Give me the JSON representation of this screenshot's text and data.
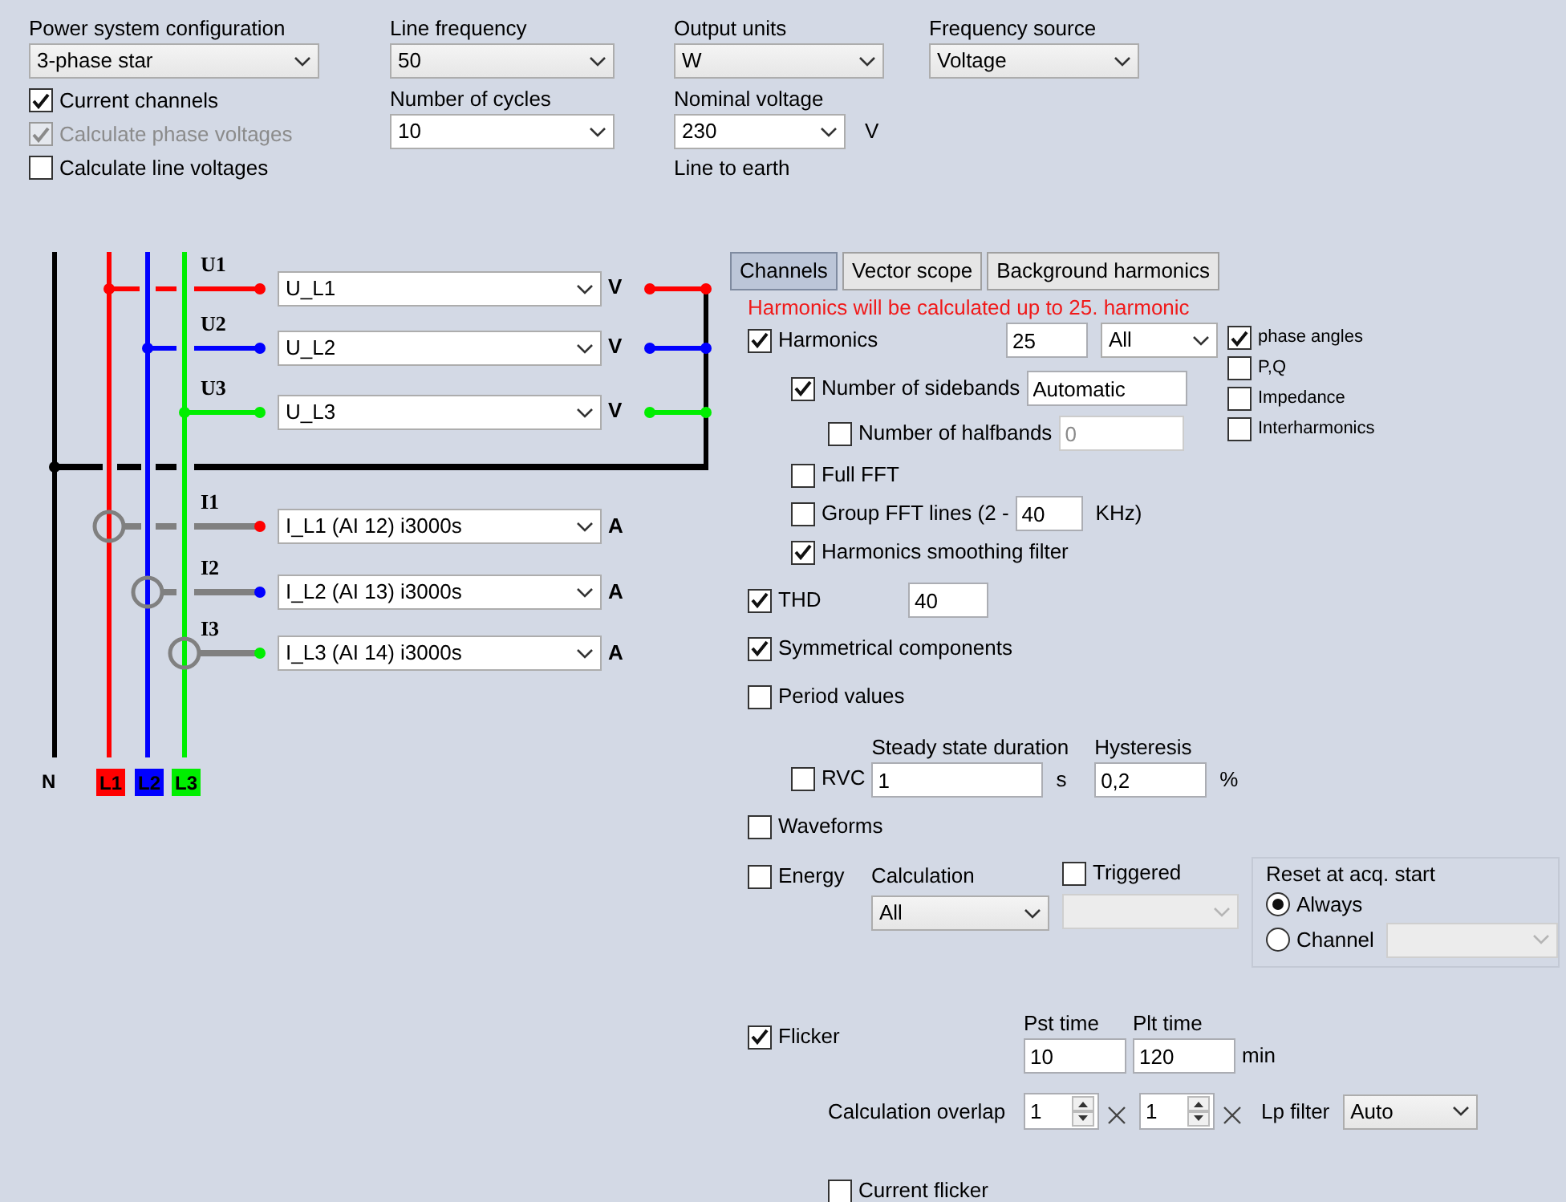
{
  "top": {
    "power_system_configuration": {
      "label": "Power system configuration",
      "value": "3-phase star"
    },
    "line_frequency": {
      "label": "Line frequency",
      "value": "50"
    },
    "output_units": {
      "label": "Output units",
      "value": "W"
    },
    "frequency_source": {
      "label": "Frequency source",
      "value": "Voltage"
    },
    "number_of_cycles": {
      "label": "Number of cycles",
      "value": "10"
    },
    "nominal_voltage": {
      "label": "Nominal voltage",
      "value": "230",
      "unit": "V",
      "note": "Line to earth"
    },
    "checkboxes": [
      {
        "label": "Current channels",
        "checked": true,
        "disabled": false
      },
      {
        "label": "Calculate phase voltages",
        "checked": true,
        "disabled": true
      },
      {
        "label": "Calculate line voltages",
        "checked": false,
        "disabled": false
      }
    ]
  },
  "diagram": {
    "neutral_label": "N",
    "phases": [
      {
        "label": "L1",
        "color": "#ff0000"
      },
      {
        "label": "L2",
        "color": "#0000ff"
      },
      {
        "label": "L3",
        "color": "#00ee00"
      }
    ],
    "voltage_channels": [
      {
        "label": "U1",
        "channel": "U_L1",
        "unit": "V"
      },
      {
        "label": "U2",
        "channel": "U_L2",
        "unit": "V"
      },
      {
        "label": "U3",
        "channel": "U_L3",
        "unit": "V"
      }
    ],
    "current_channels": [
      {
        "label": "I1",
        "channel": "I_L1 (AI 12) i3000s",
        "unit": "A"
      },
      {
        "label": "I2",
        "channel": "I_L2 (AI 13) i3000s",
        "unit": "A"
      },
      {
        "label": "I3",
        "channel": "I_L3 (AI 14) i3000s",
        "unit": "A"
      }
    ]
  },
  "tabs": [
    {
      "label": "Channels",
      "selected": true
    },
    {
      "label": "Vector scope",
      "selected": false
    },
    {
      "label": "Background harmonics",
      "selected": false
    }
  ],
  "harmonics_note": "Harmonics will be calculated up to 25. harmonic",
  "harmonics": {
    "label": "Harmonics",
    "checked": true,
    "order": "25",
    "selection": "All"
  },
  "harmonic_options": [
    {
      "label": "phase angles",
      "checked": true
    },
    {
      "label": "P,Q",
      "checked": false
    },
    {
      "label": "Impedance",
      "checked": false
    },
    {
      "label": "Interharmonics",
      "checked": false
    }
  ],
  "sidebands": {
    "label": "Number of sidebands",
    "checked": true,
    "value": "Automatic"
  },
  "halfbands": {
    "label": "Number of halfbands",
    "checked": false,
    "value": "0",
    "field_disabled": true
  },
  "full_fft": {
    "label": "Full FFT",
    "checked": false
  },
  "group_fft": {
    "label": "Group FFT lines (2 -",
    "checked": false,
    "value": "40",
    "unit": "KHz)"
  },
  "smoothing": {
    "label": "Harmonics smoothing filter",
    "checked": true
  },
  "thd": {
    "label": "THD",
    "checked": true,
    "value": "40"
  },
  "symmetrical": {
    "label": "Symmetrical components",
    "checked": true
  },
  "period_values": {
    "label": "Period values",
    "checked": false
  },
  "rvc": {
    "label": "RVC",
    "checked": false,
    "steady_label": "Steady state duration",
    "steady_value": "1",
    "steady_unit": "s",
    "hysteresis_label": "Hysteresis",
    "hysteresis_value": "0,2",
    "hysteresis_unit": "%"
  },
  "waveforms": {
    "label": "Waveforms",
    "checked": false
  },
  "energy": {
    "label": "Energy",
    "checked": false,
    "calculation_label": "Calculation",
    "calculation_value": "All",
    "triggered_label": "Triggered",
    "triggered_checked": false,
    "trigger_select_disabled": true,
    "reset": {
      "title": "Reset at acq. start",
      "channel_select_disabled": true,
      "options": [
        {
          "label": "Always",
          "selected": true
        },
        {
          "label": "Channel",
          "selected": false
        }
      ]
    }
  },
  "flicker": {
    "label": "Flicker",
    "checked": true,
    "pst_label": "Pst time",
    "pst_value": "10",
    "plt_label": "Plt time",
    "plt_value": "120",
    "unit": "min",
    "overlap_label": "Calculation overlap",
    "overlap_values": [
      "1",
      "1"
    ],
    "lp_label": "Lp filter",
    "lp_value": "Auto"
  },
  "current_flicker": {
    "label": "Current flicker",
    "checked": false
  }
}
